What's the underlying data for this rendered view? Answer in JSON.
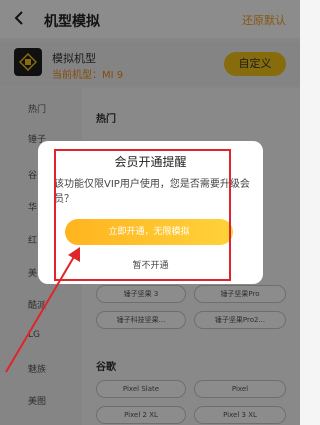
{
  "header": {
    "title": "机型模拟",
    "reset_label": "还原默认"
  },
  "model_card": {
    "name": "模拟机型",
    "current": "当前机型：MI 9",
    "customize_label": "自定义"
  },
  "sidebar": {
    "items": [
      "热门",
      "锤子",
      "谷",
      "华",
      "红",
      "美",
      "酷派",
      "LG",
      "魅族",
      "美图"
    ]
  },
  "main": {
    "section_hot": "热门",
    "hot_chips": [
      "锤子坚果 3",
      "锤子坚果Pro",
      "锤子科技坚果...",
      "锤子坚果Pro2..."
    ],
    "section_google": "谷歌",
    "google_chips": [
      "Pixel Slate",
      "Pixel",
      "Pixel 2 XL",
      "Pixel 3 XL"
    ]
  },
  "dialog": {
    "title": "会员开通提醒",
    "message": "该功能仅限VIP用户使用，您是否需要升级会员？",
    "confirm_label": "立即开通，无限模拟",
    "cancel_label": "暂不开通"
  },
  "colors": {
    "accent": "#f5c518",
    "annotation": "#e0242a"
  }
}
